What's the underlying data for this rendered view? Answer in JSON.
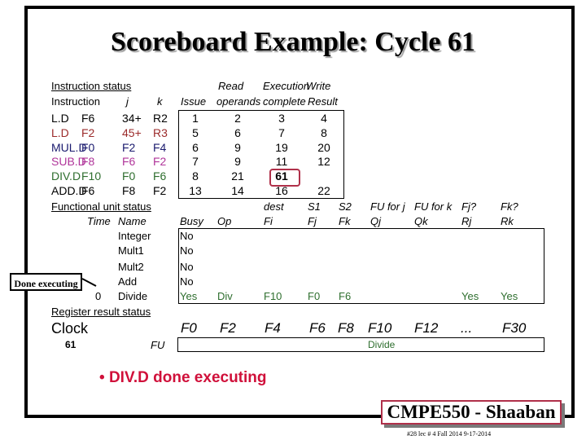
{
  "title": "Scoreboard Example:  Cycle 61",
  "instruction_status": {
    "heading": "Instruction status",
    "col_headers": {
      "instruction": "Instruction",
      "j": "j",
      "k": "k",
      "issue": "Issue",
      "read_top": "Read",
      "read_bottom": "operands",
      "exec_top": "Execution",
      "exec_bottom": "complete",
      "write_top": "Write",
      "write_bottom": "Result"
    },
    "rows": [
      {
        "op": "L.D",
        "dest": "F6",
        "j": "34+",
        "k": "R2",
        "issue": "1",
        "read": "2",
        "exec": "3",
        "write": "4",
        "color": "#000000"
      },
      {
        "op": "L.D",
        "dest": "F2",
        "j": "45+",
        "k": "R3",
        "issue": "5",
        "read": "6",
        "exec": "7",
        "write": "8",
        "color": "#9b2a2a"
      },
      {
        "op": "MUL.D",
        "dest": "F0",
        "j": "F2",
        "k": "F4",
        "issue": "6",
        "read": "9",
        "exec": "19",
        "write": "20",
        "color": "#1a1a6e"
      },
      {
        "op": "SUB.D",
        "dest": "F8",
        "j": "F6",
        "k": "F2",
        "issue": "7",
        "read": "9",
        "exec": "11",
        "write": "12",
        "color": "#b0359a"
      },
      {
        "op": "DIV.D",
        "dest": "F10",
        "j": "F0",
        "k": "F6",
        "issue": "8",
        "read": "21",
        "exec": "61",
        "write": "",
        "color": "#2e6e2e"
      },
      {
        "op": "ADD.D",
        "dest": "F6",
        "j": "F8",
        "k": "F2",
        "issue": "13",
        "read": "14",
        "exec": "16",
        "write": "22",
        "color": "#000000"
      }
    ],
    "highlighted_value": "61"
  },
  "functional_unit_status": {
    "heading": "Functional unit status",
    "col_headers": {
      "time": "Time",
      "name": "Name",
      "busy": "Busy",
      "op": "Op",
      "fi_top": "dest",
      "fi": "Fi",
      "fj_top": "S1",
      "fj": "Fj",
      "fk_top": "S2",
      "fk": "Fk",
      "qj_top": "FU for j",
      "qj": "Qj",
      "qk_top": "FU for k",
      "qk": "Qk",
      "rj_top": "Fj?",
      "rj": "Rj",
      "rk_top": "Fk?",
      "rk": "Rk"
    },
    "rows": [
      {
        "time": "",
        "name": "Integer",
        "busy": "No",
        "op": "",
        "fi": "",
        "fj": "",
        "fk": "",
        "qj": "",
        "qk": "",
        "rj": "",
        "rk": ""
      },
      {
        "time": "",
        "name": "Mult1",
        "busy": "No",
        "op": "",
        "fi": "",
        "fj": "",
        "fk": "",
        "qj": "",
        "qk": "",
        "rj": "",
        "rk": ""
      },
      {
        "time": "",
        "name": "Mult2",
        "busy": "No",
        "op": "",
        "fi": "",
        "fj": "",
        "fk": "",
        "qj": "",
        "qk": "",
        "rj": "",
        "rk": ""
      },
      {
        "time": "",
        "name": "Add",
        "busy": "No",
        "op": "",
        "fi": "",
        "fj": "",
        "fk": "",
        "qj": "",
        "qk": "",
        "rj": "",
        "rk": ""
      },
      {
        "time": "0",
        "name": "Divide",
        "busy": "Yes",
        "op": "Div",
        "fi": "F10",
        "fj": "F0",
        "fk": "F6",
        "qj": "",
        "qk": "",
        "rj": "Yes",
        "rk": "Yes"
      }
    ]
  },
  "register_result_status": {
    "heading": "Register result status",
    "clock_label": "Clock",
    "clock_value": "61",
    "fu_label": "FU",
    "registers": [
      "F0",
      "F2",
      "F4",
      "F6",
      "F8",
      "F10",
      "F12",
      "...",
      "F30"
    ],
    "values": [
      "",
      "",
      "",
      "",
      "",
      "Divide",
      "",
      "",
      ""
    ]
  },
  "callout": "Done executing",
  "bullet": "DIV.D done executing",
  "footer": {
    "course": "CMPE550 - Shaaban",
    "sub": "#28   lec # 4 Fall 2014    9-17-2014"
  },
  "colors": {
    "green": "#2e6e2e",
    "highlight_red": "#b0304a",
    "bullet_red": "#d0103a"
  }
}
